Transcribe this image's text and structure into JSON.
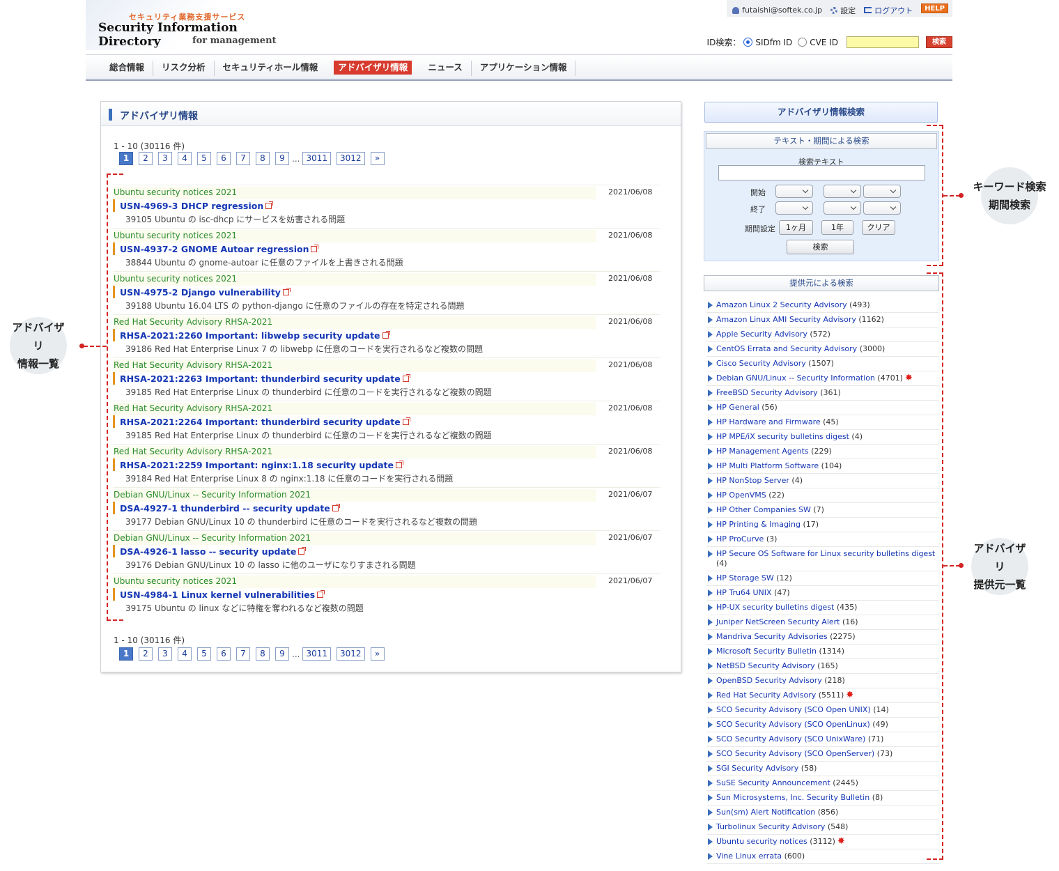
{
  "logo": {
    "subtitle": "セキュリティ業務支援サービス",
    "title": "Security Information Directory",
    "tagline": "for management"
  },
  "userbar": {
    "email": "futaishi@softek.co.jp",
    "settings": "設定",
    "logout": "ログアウト",
    "help": "HELP"
  },
  "id_search": {
    "label": "ID検索：",
    "option1": "SIDfm ID",
    "option2": "CVE ID",
    "button": "検索",
    "selected": "SIDfm ID"
  },
  "nav": {
    "items": [
      "総合情報",
      "リスク分析",
      "セキュリティホール情報",
      "アドバイザリ情報",
      "ニュース",
      "アプリケーション情報"
    ],
    "active": "アドバイザリ情報"
  },
  "main": {
    "title": "アドバイザリ情報",
    "count": "1 - 10 (30116 件)",
    "pager": {
      "pages": [
        "1",
        "2",
        "3",
        "4",
        "5",
        "6",
        "7",
        "8",
        "9"
      ],
      "dots": "...",
      "last": [
        "3011",
        "3012"
      ],
      "next": "»",
      "current": "1"
    },
    "advisories": [
      {
        "source": "Ubuntu security notices 2021",
        "date": "2021/06/08",
        "title": "USN-4969-3 DHCP regression",
        "desc": "39105 Ubuntu の isc-dhcp にサービスを妨害される問題"
      },
      {
        "source": "Ubuntu security notices 2021",
        "date": "2021/06/08",
        "title": "USN-4937-2 GNOME Autoar regression",
        "desc": "38844 Ubuntu の gnome-autoar に任意のファイルを上書きされる問題"
      },
      {
        "source": "Ubuntu security notices 2021",
        "date": "2021/06/08",
        "title": "USN-4975-2 Django vulnerability",
        "desc": "39188 Ubuntu 16.04 LTS の python-django に任意のファイルの存在を特定される問題"
      },
      {
        "source": "Red Hat Security Advisory RHSA-2021",
        "date": "2021/06/08",
        "title": "RHSA-2021:2260 Important: libwebp security update",
        "desc": "39186 Red Hat Enterprise Linux 7 の libwebp に任意のコードを実行されるなど複数の問題"
      },
      {
        "source": "Red Hat Security Advisory RHSA-2021",
        "date": "2021/06/08",
        "title": "RHSA-2021:2263 Important: thunderbird security update",
        "desc": "39185 Red Hat Enterprise Linux の thunderbird に任意のコードを実行されるなど複数の問題"
      },
      {
        "source": "Red Hat Security Advisory RHSA-2021",
        "date": "2021/06/08",
        "title": "RHSA-2021:2264 Important: thunderbird security update",
        "desc": "39185 Red Hat Enterprise Linux の thunderbird に任意のコードを実行されるなど複数の問題"
      },
      {
        "source": "Red Hat Security Advisory RHSA-2021",
        "date": "2021/06/08",
        "title": "RHSA-2021:2259 Important: nginx:1.18 security update",
        "desc": "39184 Red Hat Enterprise Linux 8 の nginx:1.18 に任意のコードを実行される問題"
      },
      {
        "source": "Debian GNU/Linux -- Security Information 2021",
        "date": "2021/06/07",
        "title": "DSA-4927-1 thunderbird -- security update",
        "desc": "39177 Debian GNU/Linux 10 の thunderbird に任意のコードを実行されるなど複数の問題"
      },
      {
        "source": "Debian GNU/Linux -- Security Information 2021",
        "date": "2021/06/07",
        "title": "DSA-4926-1 lasso -- security update",
        "desc": "39176 Debian GNU/Linux 10 の lasso に他のユーザになりすまされる問題"
      },
      {
        "source": "Ubuntu security notices 2021",
        "date": "2021/06/07",
        "title": "USN-4984-1 Linux kernel vulnerabilities",
        "desc": "39175 Ubuntu の linux などに特権を奪われるなど複数の問題"
      }
    ]
  },
  "sidebar": {
    "title": "アドバイザリ情報検索",
    "text_search": {
      "header": "テキスト・期間による検索",
      "text_label": "検索テキスト",
      "start_label": "開始",
      "end_label": "終了",
      "period_label": "期間設定",
      "btn_1month": "1ヶ月",
      "btn_1year": "1年",
      "btn_clear": "クリア",
      "btn_search": "検索"
    },
    "provider_header": "提供元による検索",
    "providers": [
      {
        "name": "Amazon Linux 2 Security Advisory",
        "count": "(493)"
      },
      {
        "name": "Amazon Linux AMI Security Advisory",
        "count": "(1162)"
      },
      {
        "name": "Apple Security Advisory",
        "count": "(572)"
      },
      {
        "name": "CentOS Errata and Security Advisory",
        "count": "(3000)"
      },
      {
        "name": "Cisco Security Advisory",
        "count": "(1507)"
      },
      {
        "name": "Debian GNU/Linux -- Security Information",
        "count": "(4701)",
        "new": true
      },
      {
        "name": "FreeBSD Security Advisory",
        "count": "(361)"
      },
      {
        "name": "HP General",
        "count": "(56)"
      },
      {
        "name": "HP Hardware and Firmware",
        "count": "(45)"
      },
      {
        "name": "HP MPE/iX security bulletins digest",
        "count": "(4)"
      },
      {
        "name": "HP Management Agents",
        "count": "(229)"
      },
      {
        "name": "HP Multi Platform Software",
        "count": "(104)"
      },
      {
        "name": "HP NonStop Server",
        "count": "(4)"
      },
      {
        "name": "HP OpenVMS",
        "count": "(22)"
      },
      {
        "name": "HP Other Companies SW",
        "count": "(7)"
      },
      {
        "name": "HP Printing & Imaging",
        "count": "(17)"
      },
      {
        "name": "HP ProCurve",
        "count": "(3)"
      },
      {
        "name": "HP Secure OS Software for Linux security bulletins digest",
        "count": "(4)",
        "tall": true
      },
      {
        "name": "HP Storage SW",
        "count": "(12)"
      },
      {
        "name": "HP Tru64 UNIX",
        "count": "(47)"
      },
      {
        "name": "HP-UX security bulletins digest",
        "count": "(435)"
      },
      {
        "name": "Juniper NetScreen Security Alert",
        "count": "(16)"
      },
      {
        "name": "Mandriva Security Advisories",
        "count": "(2275)"
      },
      {
        "name": "Microsoft Security Bulletin",
        "count": "(1314)"
      },
      {
        "name": "NetBSD Security Advisory",
        "count": "(165)"
      },
      {
        "name": "OpenBSD Security Advisory",
        "count": "(218)"
      },
      {
        "name": "Red Hat Security Advisory",
        "count": "(5511)",
        "new": true
      },
      {
        "name": "SCO Security Advisory (SCO Open UNIX)",
        "count": "(14)"
      },
      {
        "name": "SCO Security Advisory (SCO OpenLinux)",
        "count": "(49)"
      },
      {
        "name": "SCO Security Advisory (SCO UnixWare)",
        "count": "(71)"
      },
      {
        "name": "SCO Security Advisory (SCO OpenServer)",
        "count": "(73)"
      },
      {
        "name": "SGI Security Advisory",
        "count": "(58)"
      },
      {
        "name": "SuSE Security Announcement",
        "count": "(2445)"
      },
      {
        "name": "Sun Microsystems, Inc. Security Bulletin",
        "count": "(8)"
      },
      {
        "name": "Sun(sm) Alert Notification",
        "count": "(856)"
      },
      {
        "name": "Turbolinux Security Advisory",
        "count": "(548)"
      },
      {
        "name": "Ubuntu security notices",
        "count": "(3112)",
        "new": true
      },
      {
        "name": "Vine Linux errata",
        "count": "(600)"
      }
    ]
  },
  "annotations": {
    "left": [
      "アドバイザリ",
      "情報一覧"
    ],
    "keyword": [
      "キーワード検索",
      "期間検索"
    ],
    "provider": [
      "アドバイザリ",
      "提供元一覧"
    ]
  },
  "colors": {
    "accent_red": "#d73b2e",
    "link_blue": "#1537b4",
    "source_green": "#2a8c2a",
    "annotation_red": "#d42323"
  }
}
